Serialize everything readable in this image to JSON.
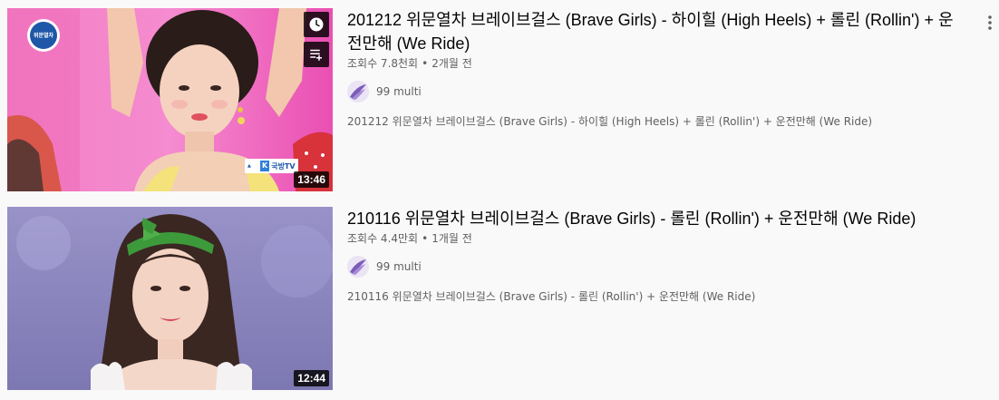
{
  "videos": [
    {
      "title": "201212 위문열차 브레이브걸스 (Brave Girls) - 하이힐 (High Heels) + 롤린 (Rollin') + 운전만해 (We Ride)",
      "views": "조회수 7.8천회",
      "age": "2개월 전",
      "channel": "99 multi",
      "description": "201212 위문열차 브레이브걸스 (Brave Girls) - 하이힐 (High Heels) + 롤린 (Rollin') + 운전만해 (We Ride)",
      "duration": "13:46",
      "overlay_logo": "위문열차",
      "overlay_broadcaster": "국방TV"
    },
    {
      "title": "210116 위문열차 브레이브걸스 (Brave Girls) - 롤린 (Rollin') + 운전만해 (We Ride)",
      "views": "조회수 4.4만회",
      "age": "1개월 전",
      "channel": "99 multi",
      "description": "210116 위문열차 브레이브걸스 (Brave Girls) - 롤린 (Rollin') + 운전만해 (We Ride)",
      "duration": "12:44"
    }
  ],
  "separator": "•",
  "icons": {
    "watch_later": "clock-icon",
    "add_to_queue": "queue-icon",
    "more": "more-vert-icon"
  },
  "colors": {
    "background": "#f9f9f9",
    "title": "#030303",
    "secondary": "#606060"
  }
}
